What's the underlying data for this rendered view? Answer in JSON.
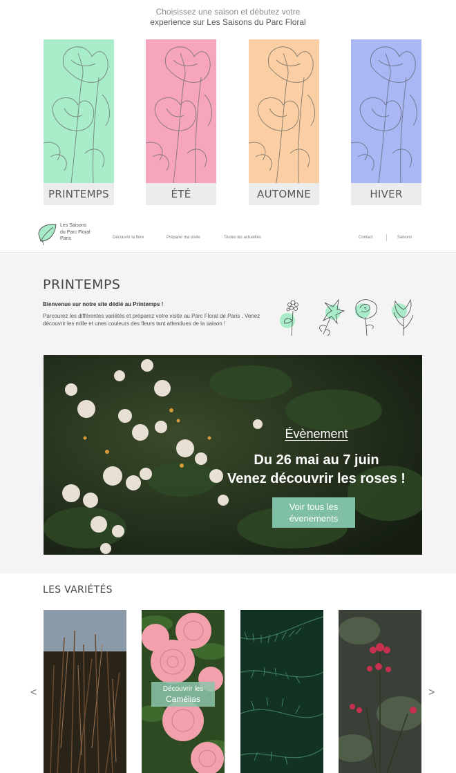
{
  "intro": {
    "line1": "Choisissez une saison et débutez votre",
    "line2": "experience sur Les Saisons du Parc Floral"
  },
  "seasons": [
    {
      "label": "PRINTEMPS",
      "color": "#a8ecca"
    },
    {
      "label": "ÉTÉ",
      "color": "#f6a5bd"
    },
    {
      "label": "AUTOMNE",
      "color": "#fbcfa3"
    },
    {
      "label": "HIVER",
      "color": "#a9b8f5"
    }
  ],
  "nav": {
    "logo_line1": "Les Saisons",
    "logo_line2": "du Parc Floral",
    "logo_line3": "Paris",
    "links": [
      "Découvrir la flore",
      "Préparer ma visite",
      "Toutes les actualités"
    ],
    "contact": "Contact",
    "saisons": "Saisons"
  },
  "spring": {
    "title": "PRINTEMPS",
    "welcome": "Bienvenue sur notre site dédié au Printemps !",
    "description": "Parcourez les différentes variétés et préparez votre visite au Parc Floral de Paris . Venez découvrir les mille et unes couleurs des fleurs tant attendues de la saison !",
    "accent": "#a8ecca"
  },
  "event": {
    "label": "Évènement",
    "dates": "Du 26 mai au 7 juin",
    "subtitle": "Venez découvrir les roses !",
    "button_line1": "Voir tous les",
    "button_line2": "évenements"
  },
  "varieties": {
    "title": "LES VARIÉTÉS",
    "button_line1": "Découvrir les",
    "button_line2": "Camélias",
    "prev": "<",
    "next": ">"
  }
}
